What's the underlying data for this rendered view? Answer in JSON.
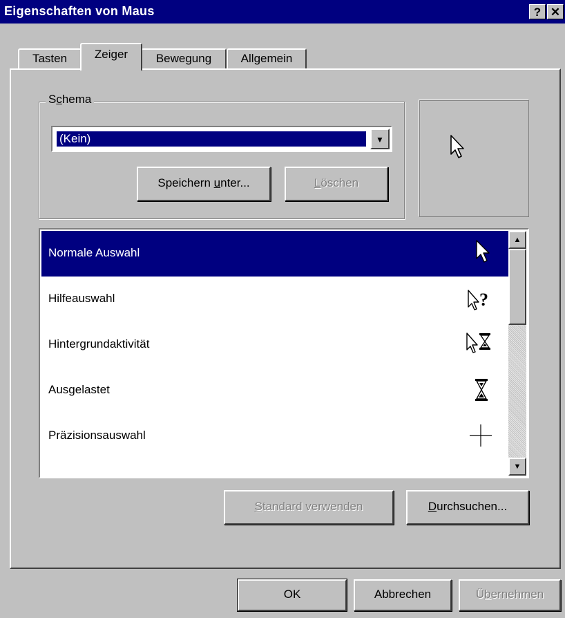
{
  "window": {
    "title": "Eigenschaften von Maus",
    "help_label": "?",
    "close_label": "✕"
  },
  "tabs": [
    {
      "label": "Tasten",
      "active": false
    },
    {
      "label": "Zeiger",
      "active": true
    },
    {
      "label": "Bewegung",
      "active": false
    },
    {
      "label": "Allgemein",
      "active": false
    }
  ],
  "schema": {
    "group_label_pre": "S",
    "group_label_underline": "c",
    "group_label_post": "hema",
    "selected_value": "(Kein)",
    "save_as_pre": "Speichern ",
    "save_as_underline": "u",
    "save_as_post": "nter...",
    "delete_pre": "",
    "delete_underline": "L",
    "delete_post": "öschen"
  },
  "cursor_list": [
    {
      "label": "Normale Auswahl",
      "icon": "arrow-pointer-icon",
      "selected": true
    },
    {
      "label": "Hilfeauswahl",
      "icon": "help-pointer-icon",
      "selected": false
    },
    {
      "label": "Hintergrundaktivität",
      "icon": "working-in-background-icon",
      "selected": false
    },
    {
      "label": "Ausgelastet",
      "icon": "hourglass-icon",
      "selected": false
    },
    {
      "label": "Präzisionsauswahl",
      "icon": "crosshair-icon",
      "selected": false
    }
  ],
  "actions": {
    "use_default_underline": "S",
    "use_default_post": "tandard verwenden",
    "browse_underline": "D",
    "browse_post": "urchsuchen..."
  },
  "footer": {
    "ok_label": "OK",
    "cancel_label": "Abbrechen",
    "apply_pre": "Ü",
    "apply_underline": "b",
    "apply_post": "ernehmen"
  },
  "colors": {
    "title_bar": "#000080",
    "face": "#c0c0c0",
    "selection": "#000080"
  }
}
